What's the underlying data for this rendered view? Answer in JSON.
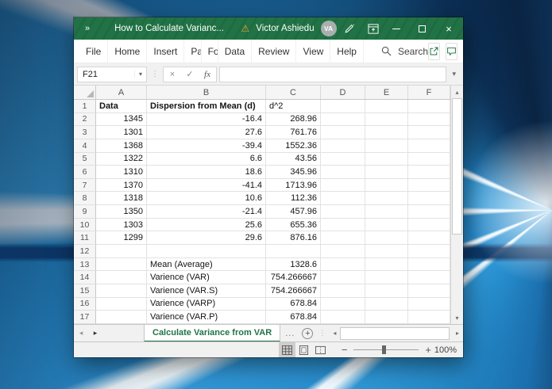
{
  "titlebar": {
    "overflow_button": "»",
    "title": "How to Calculate Varianc...",
    "user_name": "Victor Ashiedu",
    "avatar_initials": "VA",
    "warning_icon": "⚠"
  },
  "ribbon": {
    "tabs": [
      "File",
      "Home",
      "Insert",
      "Page Lay",
      "Formulas",
      "Data",
      "Review",
      "View",
      "Help"
    ],
    "search_label": "Search"
  },
  "formula_bar": {
    "name_box_value": "F21",
    "cancel_glyph": "×",
    "enter_glyph": "✓",
    "fx_label": "fx",
    "formula_value": ""
  },
  "grid": {
    "column_headers": [
      "A",
      "B",
      "C",
      "D",
      "E",
      "F"
    ],
    "rows": [
      {
        "n": "1",
        "a": "Data",
        "b": "Dispersion from Mean (d)",
        "c": "d^2"
      },
      {
        "n": "2",
        "a": "1345",
        "b": "-16.4",
        "c": "268.96"
      },
      {
        "n": "3",
        "a": "1301",
        "b": "27.6",
        "c": "761.76"
      },
      {
        "n": "4",
        "a": "1368",
        "b": "-39.4",
        "c": "1552.36"
      },
      {
        "n": "5",
        "a": "1322",
        "b": "6.6",
        "c": "43.56"
      },
      {
        "n": "6",
        "a": "1310",
        "b": "18.6",
        "c": "345.96"
      },
      {
        "n": "7",
        "a": "1370",
        "b": "-41.4",
        "c": "1713.96"
      },
      {
        "n": "8",
        "a": "1318",
        "b": "10.6",
        "c": "112.36"
      },
      {
        "n": "9",
        "a": "1350",
        "b": "-21.4",
        "c": "457.96"
      },
      {
        "n": "10",
        "a": "1303",
        "b": "25.6",
        "c": "655.36"
      },
      {
        "n": "11",
        "a": "1299",
        "b": "29.6",
        "c": "876.16"
      },
      {
        "n": "12",
        "a": "",
        "b": "",
        "c": ""
      },
      {
        "n": "13",
        "a": "",
        "b": "Mean (Average)",
        "c": "1328.6"
      },
      {
        "n": "14",
        "a": "",
        "b": "Varience (VAR)",
        "c": "754.266667"
      },
      {
        "n": "15",
        "a": "",
        "b": "Varience (VAR.S)",
        "c": "754.266667"
      },
      {
        "n": "16",
        "a": "",
        "b": "Varience (VARP)",
        "c": "678.84"
      },
      {
        "n": "17",
        "a": "",
        "b": "Varience (VAR.P)",
        "c": "678.84"
      }
    ]
  },
  "sheet_bar": {
    "active_tab": "Calculate Variance from VAR",
    "more_sheets": "..."
  },
  "status_bar": {
    "zoom_level": "100%"
  },
  "colors": {
    "excel_green": "#217346",
    "warning_orange": "#f0a030",
    "titlebar_text": "#ffffff"
  }
}
